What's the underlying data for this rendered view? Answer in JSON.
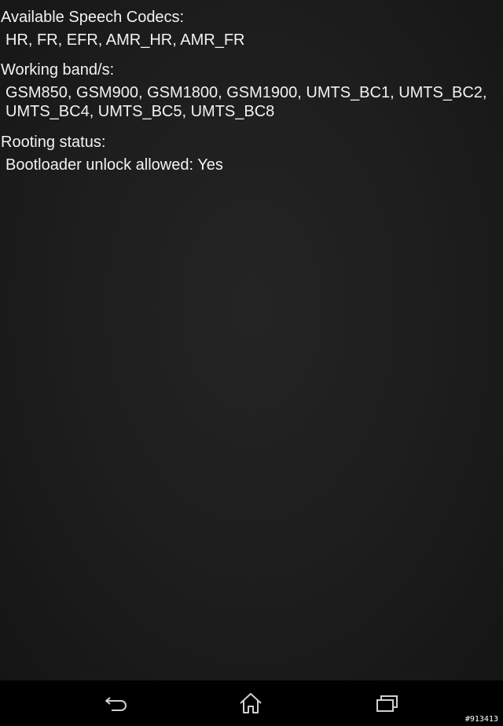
{
  "sections": [
    {
      "label": "Available Speech Codecs:",
      "value": "HR, FR, EFR, AMR_HR, AMR_FR"
    },
    {
      "label": "Working band/s:",
      "value": "GSM850, GSM900, GSM1800, GSM1900, UMTS_BC1, UMTS_BC2, UMTS_BC4, UMTS_BC5, UMTS_BC8"
    },
    {
      "label": "Rooting status:",
      "value": "Bootloader unlock allowed: Yes"
    }
  ],
  "navbar": {
    "back_icon": "back-icon",
    "home_icon": "home-icon",
    "recents_icon": "recents-icon"
  },
  "watermark": "#913413"
}
